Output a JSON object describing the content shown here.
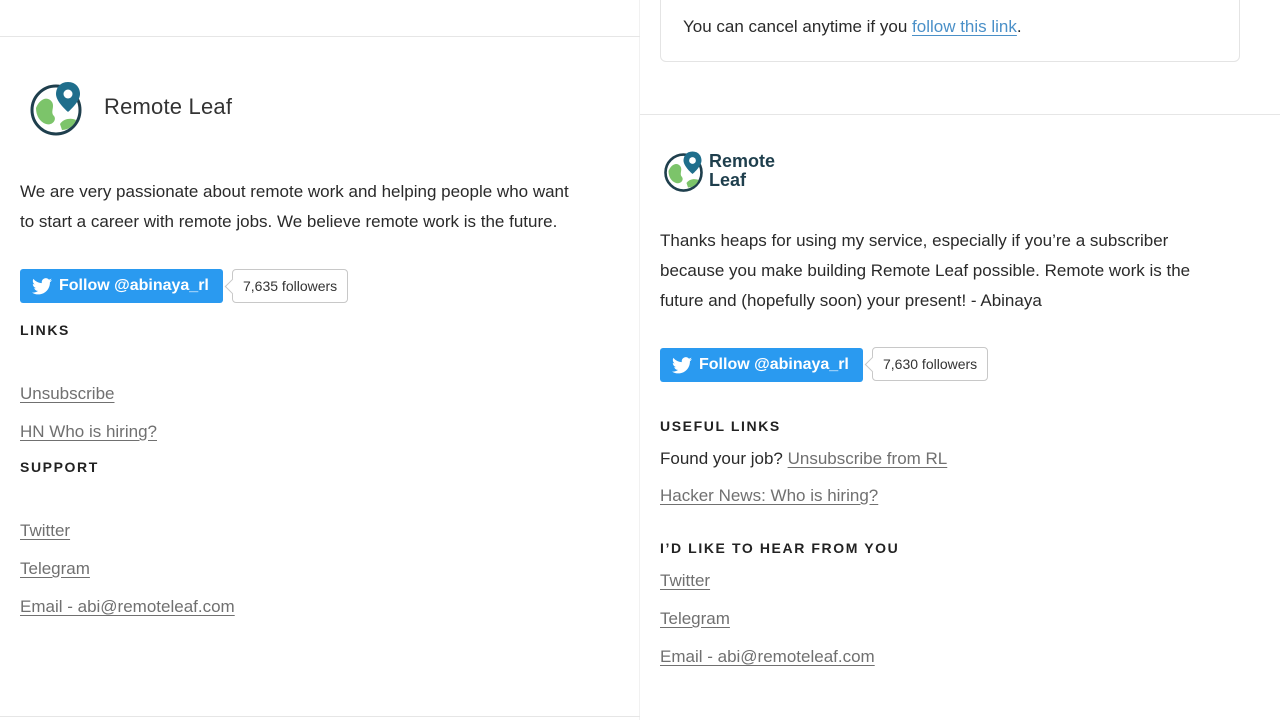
{
  "left": {
    "brand_name": "Remote Leaf",
    "intro_line1": "We are very passionate about remote work and helping people who want",
    "intro_line2": "to start a career with remote jobs. We believe remote work is the future.",
    "follow_label": "Follow @abinaya_rl",
    "followers": "7,635 followers",
    "links_heading": "LINKS",
    "links": [
      "Unsubscribe",
      "HN Who is hiring?"
    ],
    "support_heading": "SUPPORT",
    "support_links": [
      "Twitter",
      "Telegram",
      "Email - abi@remoteleaf.com"
    ]
  },
  "right": {
    "notice_prefix": "You can cancel anytime if you ",
    "notice_link": "follow this link",
    "notice_suffix": ".",
    "brand_line1": "Remote",
    "brand_line2": "Leaf",
    "thanks_line1": "Thanks heaps for using my service, especially if you’re a subscriber",
    "thanks_line2": "because you make building Remote Leaf possible. Remote work is the",
    "thanks_line3": "future and (hopefully soon) your present! - Abinaya",
    "follow_label": "Follow @abinaya_rl",
    "followers": "7,630 followers",
    "useful_heading": "USEFUL LINKS",
    "found_job_text": "Found your job? ",
    "unsubscribe_link": "Unsubscribe from RL",
    "hn_link": "Hacker News: Who is hiring?",
    "hear_heading": "I’D LIKE TO HEAR FROM YOU",
    "contact_links": [
      "Twitter",
      "Telegram",
      "Email - abi@remoteleaf.com"
    ]
  },
  "icons": {
    "logo": "globe-pin-icon",
    "twitter": "twitter-bird-icon"
  },
  "colors": {
    "twitter_blue": "#2a9af0",
    "logo_green": "#7cc46a",
    "logo_teal": "#1f6e8c",
    "logo_dark": "#1f3f4d",
    "link_gray": "#707070",
    "notice_link_blue": "#4a90c8"
  }
}
